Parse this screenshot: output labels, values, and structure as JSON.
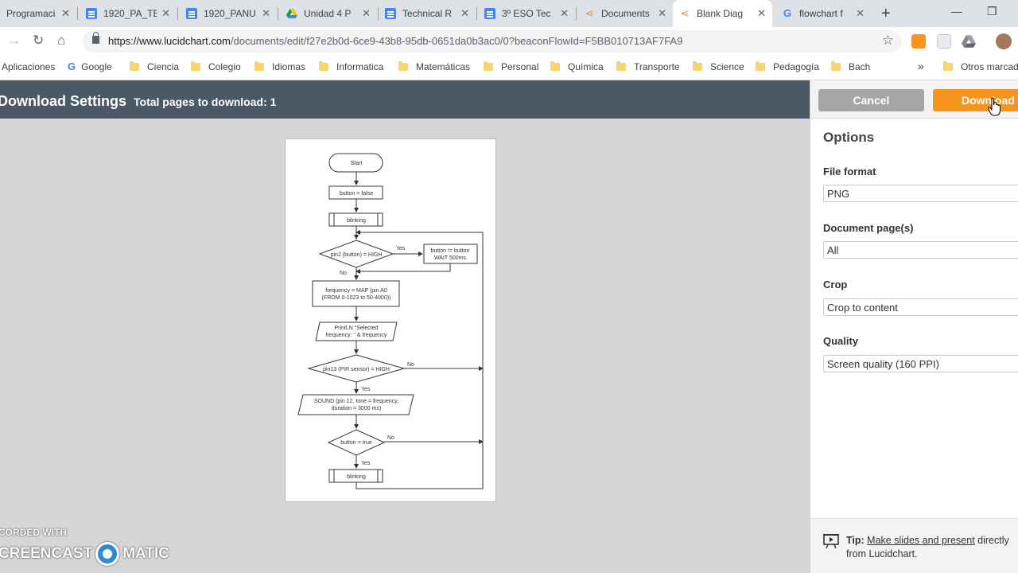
{
  "browser": {
    "tabs": [
      {
        "title": "Programaci",
        "icon": "generic-page-icon",
        "close": "✕"
      },
      {
        "title": "1920_PA_TE",
        "icon": "google-docs-icon",
        "close": "✕"
      },
      {
        "title": "1920_PANU",
        "icon": "google-docs-icon",
        "close": "✕"
      },
      {
        "title": "Unidad 4 P",
        "icon": "google-drive-icon",
        "close": "✕"
      },
      {
        "title": "Technical R",
        "icon": "google-docs-icon",
        "close": "✕"
      },
      {
        "title": "3º ESO Tec",
        "icon": "google-docs-icon",
        "close": "✕"
      },
      {
        "title": "Documents",
        "icon": "lucidchart-icon",
        "close": "✕"
      },
      {
        "title": "Blank Diag",
        "icon": "lucidchart-icon",
        "close": "✕",
        "active": true
      },
      {
        "title": "flowchart f",
        "icon": "google-icon",
        "close": "✕"
      }
    ],
    "new_tab": "+",
    "url_host": "https://www.lucidchart.com",
    "url_path": "/documents/edit/f27e2b0d-6ce9-43b8-95db-0651da0b3ac0/0?beaconFlowId=F5BB010713AF7FA9",
    "bookmarks": [
      {
        "label": "Aplicaciones",
        "icon": "apps-icon"
      },
      {
        "label": "Google",
        "icon": "google-icon"
      },
      {
        "label": "Ciencia",
        "icon": "folder-icon"
      },
      {
        "label": "Colegio",
        "icon": "folder-icon"
      },
      {
        "label": "Idiomas",
        "icon": "folder-icon"
      },
      {
        "label": "Informatica",
        "icon": "folder-icon"
      },
      {
        "label": "Matemáticas",
        "icon": "folder-icon"
      },
      {
        "label": "Personal",
        "icon": "folder-icon"
      },
      {
        "label": "Química",
        "icon": "folder-icon"
      },
      {
        "label": "Transporte",
        "icon": "folder-icon"
      },
      {
        "label": "Science",
        "icon": "folder-icon"
      },
      {
        "label": "Pedagogía",
        "icon": "folder-icon"
      },
      {
        "label": "Bach",
        "icon": "folder-icon"
      }
    ],
    "bookmarks_more": "»",
    "other_bookmarks": "Otros marcad"
  },
  "app": {
    "title": "Download Settings",
    "subtitle": "Total pages to download: 1",
    "cancel_label": "Cancel",
    "download_label": "Download",
    "options_title": "Options",
    "fields": [
      {
        "label": "File format",
        "value": "PNG"
      },
      {
        "label": "Document page(s)",
        "value": "All"
      },
      {
        "label": "Crop",
        "value": "Crop to content"
      },
      {
        "label": "Quality",
        "value": "Screen quality (160 PPI)"
      }
    ],
    "tip": {
      "prefix": "Tip:",
      "link": "Make slides and present",
      "suffix": "directly from Lucidchart."
    },
    "accent_color": "#f7941e",
    "header_color": "#4b5866"
  },
  "flowchart": {
    "start": "Start",
    "init": "button = false",
    "blinking1": "blinking",
    "decision1": "pin2 (button) = HIGH",
    "yes1": "Yes",
    "no1": "No",
    "toggle_l1": "button != button",
    "toggle_l2": "WAIT 500ms",
    "map_l1": "frequency = MAP (pin A0",
    "map_l2": "(FROM 0-1023 to 50-4000))",
    "print_l1": "PrintLN    \"Selected",
    "print_l2": "frequency: \" & frequency",
    "decision2": "pin13 (PIR sensor) = HIGH",
    "no2": "No",
    "yes2": "Yes",
    "sound_l1": "SOUND (pin 12, tone = frequency,",
    "sound_l2": "duration = 3000 ms)",
    "decision3": "button = true",
    "no3": "No",
    "yes3": "Yes",
    "blinking2": "blinking"
  },
  "watermark": {
    "top": "CORDED WITH",
    "left": "CREENCAST",
    "right": "MATIC"
  }
}
